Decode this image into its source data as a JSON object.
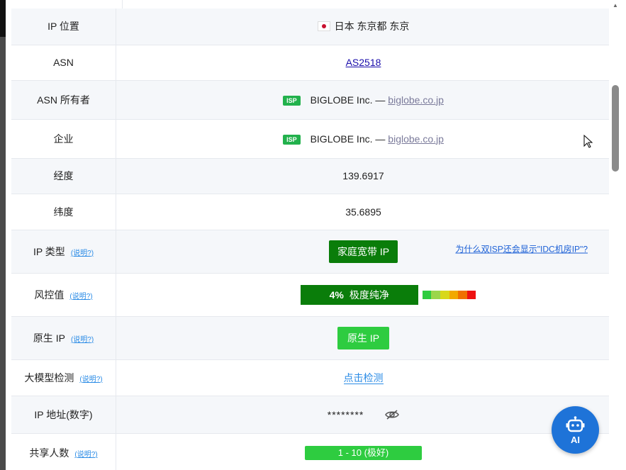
{
  "rows": [
    {
      "key": "IP 位置",
      "value": "日本 东京都 东京",
      "type": "location",
      "alt": true
    },
    {
      "key": "ASN",
      "value": "AS2518",
      "type": "asn",
      "alt": false
    },
    {
      "key": "ASN 所有者",
      "badge": "ISP",
      "value": "BIGLOBE Inc. —",
      "domain": "biglobe.co.jp",
      "type": "org",
      "alt": true
    },
    {
      "key": "企业",
      "badge": "ISP",
      "value": "BIGLOBE Inc. —",
      "domain": "biglobe.co.jp",
      "type": "org",
      "alt": false
    },
    {
      "key": "经度",
      "value": "139.6917",
      "type": "text",
      "alt": true
    },
    {
      "key": "纬度",
      "value": "35.6895",
      "type": "text",
      "alt": false
    },
    {
      "key": "IP 类型",
      "help": "(说明?)",
      "value": "家庭宽带 IP",
      "link": "为什么双ISP还会显示\"IDC机房IP\"?",
      "type": "iptype",
      "alt": true
    },
    {
      "key": "风控值",
      "help": "(说明?)",
      "percent": "4%",
      "value": "极度纯净",
      "risk_level": 0.04,
      "type": "risk",
      "alt": false
    },
    {
      "key": "原生 IP",
      "help": "(说明?)",
      "value": "原生 IP",
      "type": "native",
      "alt": true
    },
    {
      "key": "大模型检测",
      "help": "(说明?)",
      "value": "点击检测",
      "type": "check",
      "alt": false
    },
    {
      "key": "IP 地址(数字)",
      "value": "********",
      "icon": "eye-slash-icon",
      "type": "masked",
      "alt": true
    },
    {
      "key": "共享人数",
      "help": "(说明?)",
      "value": "1 - 10 (极好)",
      "type": "shared",
      "alt": false
    }
  ],
  "risk_colors": [
    "#2ecc40",
    "#9bd64a",
    "#d8d81a",
    "#f2a900",
    "#f07000",
    "#ee1111"
  ],
  "ai_button": {
    "label": "AI",
    "icon": "robot-icon"
  },
  "colors": {
    "accent": "#1e73d8",
    "green_dark": "#0a7d0a",
    "green_light": "#2ecc40"
  }
}
